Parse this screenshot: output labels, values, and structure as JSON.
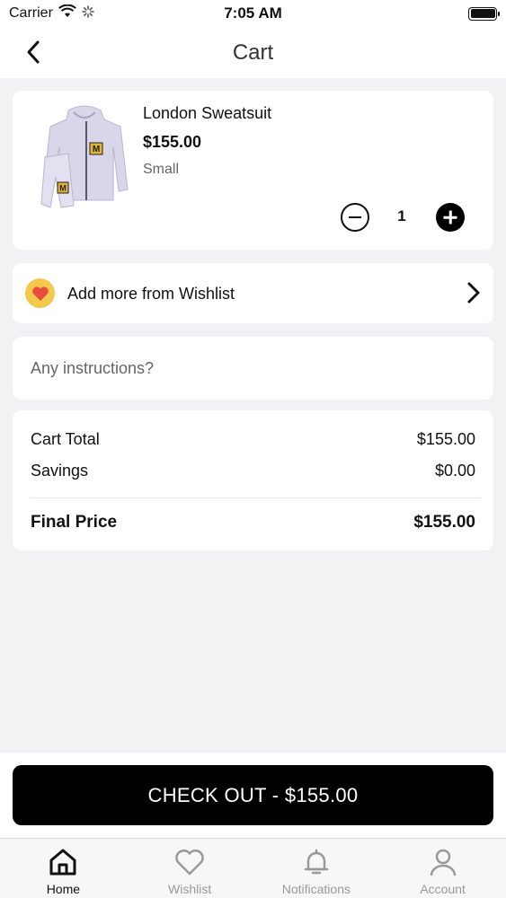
{
  "status_bar": {
    "carrier": "Carrier",
    "time": "7:05 AM"
  },
  "nav": {
    "title": "Cart",
    "back_icon": "chevron-left-icon"
  },
  "cart_item": {
    "name": "London Sweatsuit",
    "price": "$155.00",
    "size": "Small",
    "quantity": "1"
  },
  "wishlist_link": {
    "label": "Add more from Wishlist",
    "icon": "heart-icon"
  },
  "instructions": {
    "placeholder": "Any instructions?",
    "value": ""
  },
  "summary": {
    "cart_total_label": "Cart Total",
    "cart_total_value": "$155.00",
    "savings_label": "Savings",
    "savings_value": "$0.00",
    "final_label": "Final Price",
    "final_value": "$155.00"
  },
  "checkout": {
    "label": "CHECK OUT - $155.00"
  },
  "tabs": [
    {
      "label": "Home",
      "icon": "home-icon",
      "active": true
    },
    {
      "label": "Wishlist",
      "icon": "heart-icon",
      "active": false
    },
    {
      "label": "Notifications",
      "icon": "bell-icon",
      "active": false
    },
    {
      "label": "Account",
      "icon": "user-icon",
      "active": false
    }
  ],
  "colors": {
    "accent": "#000000",
    "heart_badge": "#f2c94c",
    "heart": "#e74c3c",
    "background": "#f2f2f4"
  }
}
